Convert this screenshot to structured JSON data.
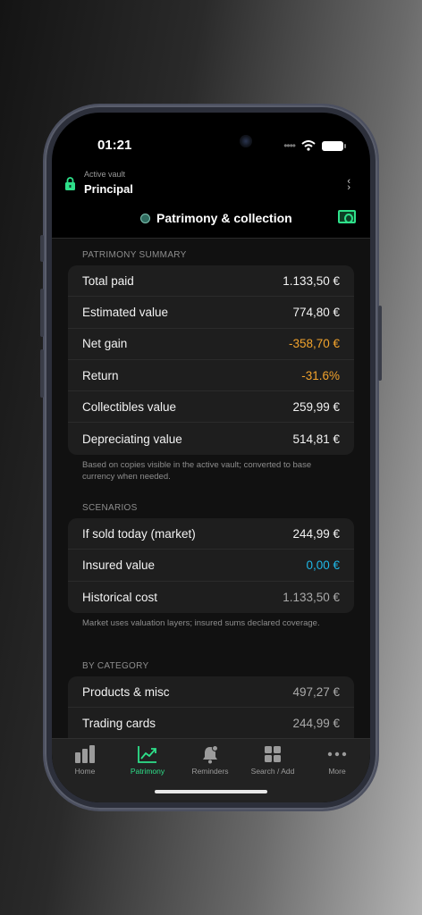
{
  "status": {
    "time": "01:21"
  },
  "vault": {
    "subtitle": "Active vault",
    "name": "Principal"
  },
  "header": {
    "title": "Patrimony & collection"
  },
  "summary": {
    "heading": "PATRIMONY SUMMARY",
    "rows": [
      {
        "label": "Total paid",
        "value": "1.133,50 €"
      },
      {
        "label": "Estimated value",
        "value": "774,80 €"
      },
      {
        "label": "Net gain",
        "value": "-358,70 €"
      },
      {
        "label": "Return",
        "value": "-31.6%"
      },
      {
        "label": "Collectibles value",
        "value": "259,99 €"
      },
      {
        "label": "Depreciating value",
        "value": "514,81 €"
      }
    ],
    "footnote": "Based on copies visible in the active vault; converted to base currency when needed."
  },
  "scenarios": {
    "heading": "SCENARIOS",
    "rows": [
      {
        "label": "If sold today (market)",
        "value": "244,99 €"
      },
      {
        "label": "Insured value",
        "value": "0,00 €"
      },
      {
        "label": "Historical cost",
        "value": "1.133,50 €"
      }
    ],
    "footnote": "Market uses valuation layers; insured sums declared coverage."
  },
  "category": {
    "heading": "BY CATEGORY",
    "rows": [
      {
        "label": "Products & misc",
        "value": "497,27 €"
      },
      {
        "label": "Trading cards",
        "value": "244,99 €"
      }
    ]
  },
  "tabs": [
    {
      "label": "Home",
      "icon": "bar-chart-icon"
    },
    {
      "label": "Patrimony",
      "icon": "trend-up-icon"
    },
    {
      "label": "Reminders",
      "icon": "bell-icon"
    },
    {
      "label": "Search / Add",
      "icon": "grid-icon"
    },
    {
      "label": "More",
      "icon": "more-icon"
    }
  ],
  "colors": {
    "accent": "#2ee08a",
    "negative": "#f2a32c",
    "info": "#1fb7e6"
  }
}
